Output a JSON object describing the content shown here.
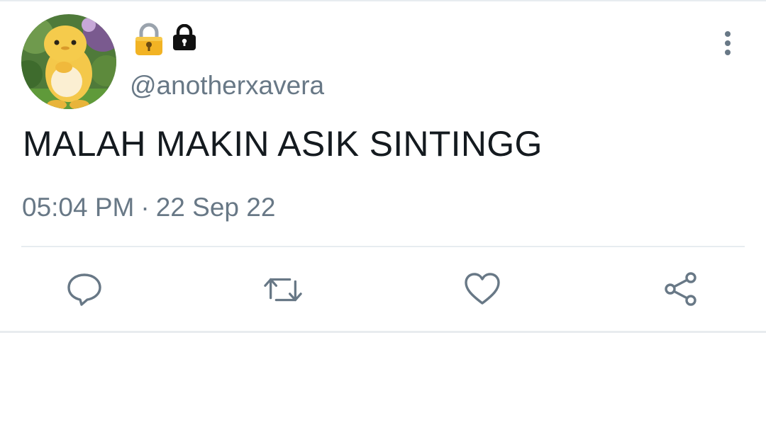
{
  "tweet": {
    "handle": "@anotherxavera",
    "text": "MALAH MAKIN ASIK SINTINGG",
    "time": "05:04 PM",
    "separator": "·",
    "date": "22 Sep 22"
  },
  "icons": {
    "name_emojis": [
      "lock-emoji-icon",
      "black-lock-icon"
    ],
    "menu": "more-vertical-icon",
    "actions": [
      "reply-icon",
      "retweet-icon",
      "like-icon",
      "share-icon"
    ]
  },
  "colors": {
    "text_primary": "#141a1f",
    "text_secondary": "#687886",
    "icon_gray": "#687886",
    "divider": "#e7ecf0"
  }
}
